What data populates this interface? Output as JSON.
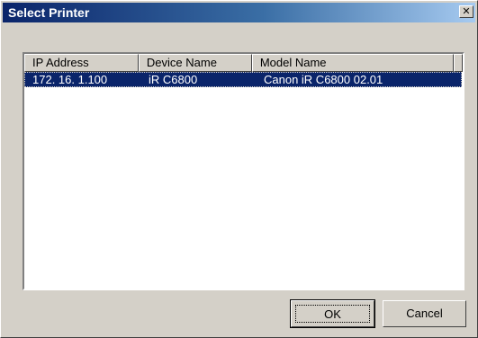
{
  "window": {
    "title": "Select Printer",
    "close_glyph": "✕"
  },
  "listview": {
    "columns": [
      "IP Address",
      "Device Name",
      "Model Name"
    ],
    "rows": [
      {
        "ip": "172. 16.  1.100",
        "device": "iR C6800",
        "model": "Canon iR C6800 02.01",
        "selected": true
      }
    ]
  },
  "buttons": {
    "ok_label": "OK",
    "cancel_label": "Cancel"
  },
  "colors": {
    "title_bar_start": "#0a246a",
    "title_bar_end": "#a6caf0",
    "selection": "#0a246a",
    "face": "#d4d0c8"
  }
}
